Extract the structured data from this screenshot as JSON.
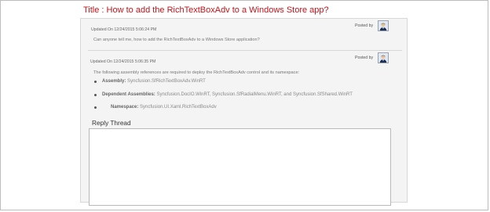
{
  "page": {
    "title_prefix": "Title : ",
    "title": "How to add the RichTextBoxAdv to a Windows Store app?"
  },
  "posts": [
    {
      "updated": "Updated On 12/24/2015 5:06:24 PM",
      "posted_by": "Posted by",
      "message": "Can anyone tell me, how to add the RichTextBoxAdv to a Windows Store application?"
    },
    {
      "updated": "Updated On 12/24/2015 5:06:35 PM",
      "posted_by": "Posted by",
      "message": "The following assembly references are required to deploy the RichTextBoxAdv control and its namespace:",
      "items": [
        {
          "label": "Assembly: ",
          "value": "Syncfusion.SfRichTextBoxAdv.WinRT"
        },
        {
          "label": "Dependent Assemblies: ",
          "value": "Syncfusion.DocIO.WinRT, Syncfusion.SfRadialMenu.WinRT, and Syncfusion.SfShared.WinRT"
        },
        {
          "label": "Namespace: ",
          "value": "Syncfusion.UI.Xaml.RichTextBoxAdv"
        }
      ]
    }
  ],
  "reply": {
    "title": "Reply Thread",
    "value": ""
  },
  "colors": {
    "title": "#c0161b",
    "panel_bg": "#f4f4f4"
  }
}
